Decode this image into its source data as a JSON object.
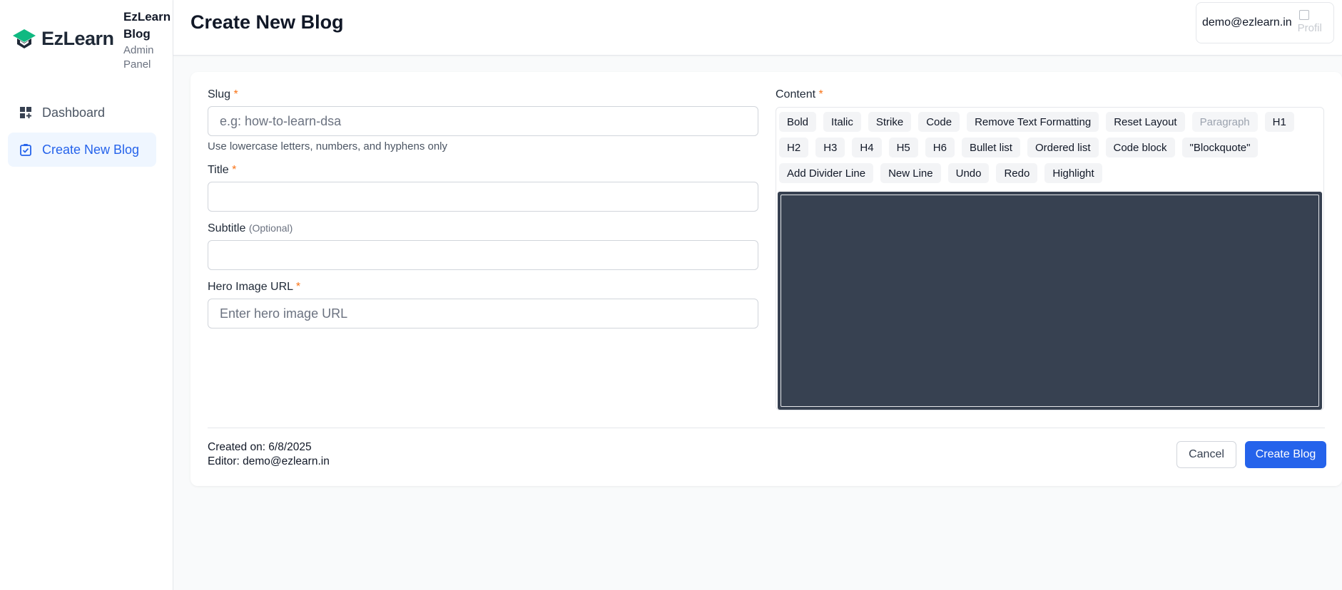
{
  "brand": {
    "logo_text": "EzLearn",
    "title": "EzLearn Blog",
    "subtitle": "Admin Panel",
    "accent": "#10b981"
  },
  "sidebar": {
    "items": [
      {
        "label": "Dashboard",
        "icon": "dashboard-icon",
        "active": false
      },
      {
        "label": "Create New Blog",
        "icon": "clipboard-check-icon",
        "active": true
      }
    ]
  },
  "header": {
    "title": "Create New Blog",
    "user_email": "demo@ezlearn.in",
    "avatar_alt": "Profil"
  },
  "form": {
    "slug": {
      "label": "Slug",
      "required": "*",
      "placeholder": "e.g: how-to-learn-dsa",
      "value": "",
      "hint": "Use lowercase letters, numbers, and hyphens only"
    },
    "title": {
      "label": "Title",
      "required": "*",
      "value": ""
    },
    "subtitle": {
      "label": "Subtitle",
      "optional": "(Optional)",
      "value": ""
    },
    "hero_image": {
      "label": "Hero Image URL",
      "required": "*",
      "placeholder": "Enter hero image URL",
      "value": ""
    },
    "content": {
      "label": "Content",
      "required": "*"
    }
  },
  "toolbar": {
    "buttons": [
      "Bold",
      "Italic",
      "Strike",
      "Code",
      "Remove Text Formatting",
      "Reset Layout",
      "Paragraph",
      "H1",
      "H2",
      "H3",
      "H4",
      "H5",
      "H6",
      "Bullet list",
      "Ordered list",
      "Code block",
      "\"Blockquote\"",
      "Add Divider Line",
      "New Line",
      "Undo",
      "Redo",
      "Highlight"
    ]
  },
  "footer": {
    "created_on": "Created on: 6/8/2025",
    "editor": "Editor: demo@ezlearn.in",
    "cancel_label": "Cancel",
    "create_label": "Create Blog"
  },
  "colors": {
    "primary": "#2563eb",
    "editor_bg": "#374151",
    "required": "#f97316"
  }
}
